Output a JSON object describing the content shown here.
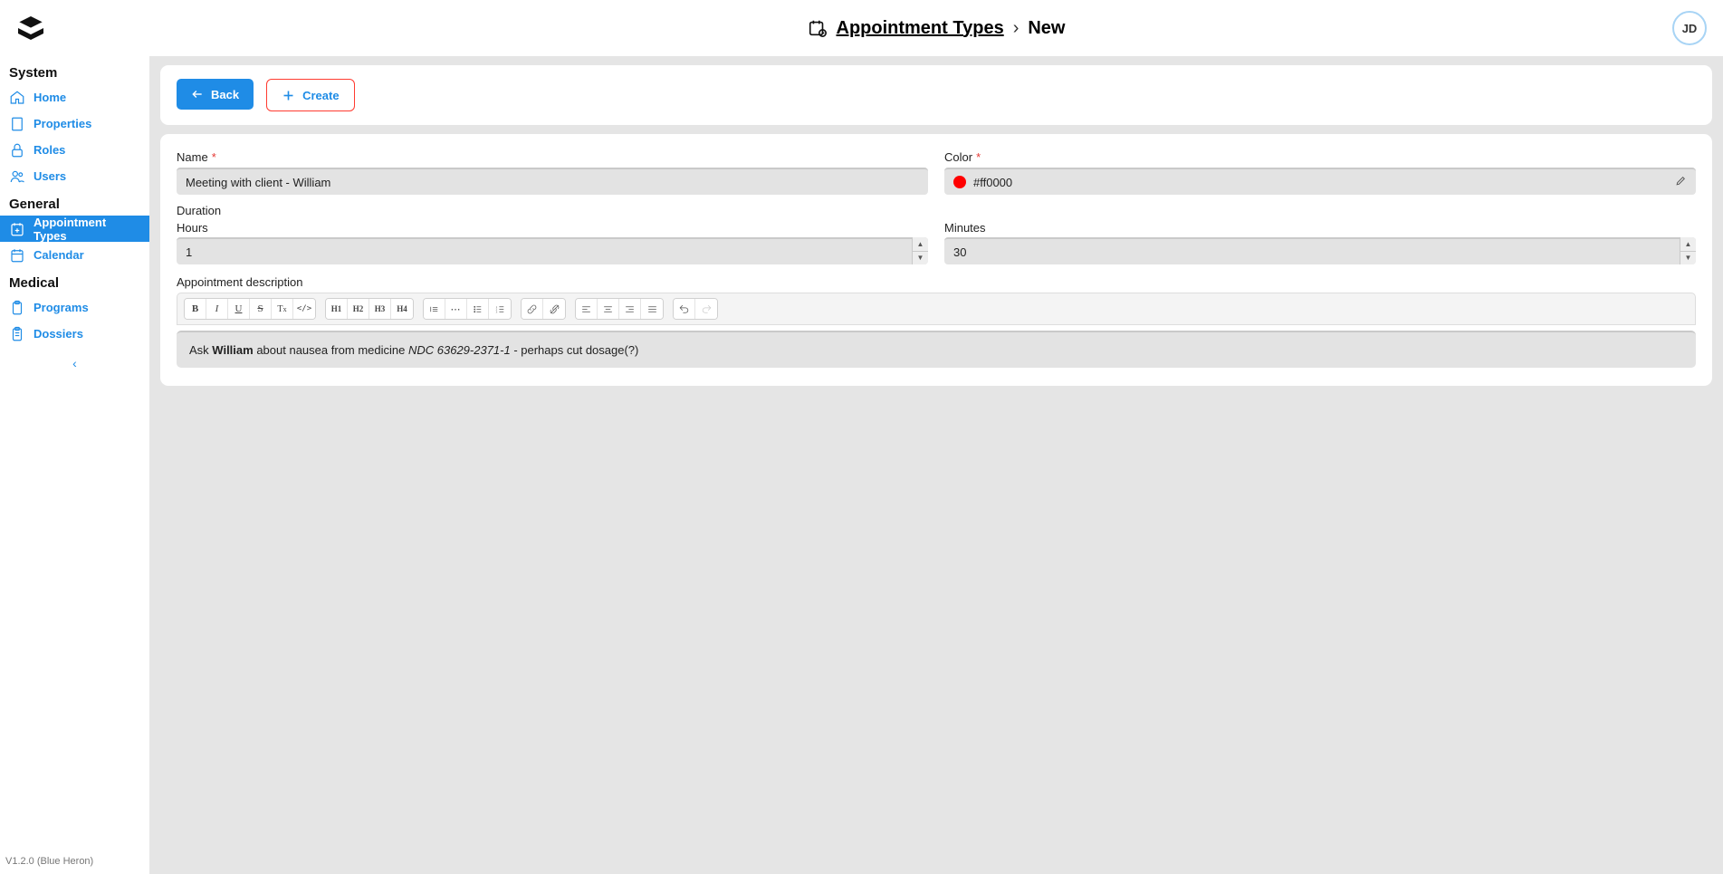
{
  "header": {
    "breadcrumb_link": "Appointment Types",
    "breadcrumb_sep": "›",
    "breadcrumb_current": "New",
    "avatar_initials": "JD"
  },
  "sidebar": {
    "sections": {
      "system": {
        "title": "System",
        "items": [
          {
            "label": "Home"
          },
          {
            "label": "Properties"
          },
          {
            "label": "Roles"
          },
          {
            "label": "Users"
          }
        ]
      },
      "general": {
        "title": "General",
        "items": [
          {
            "label": "Appointment Types",
            "active": true
          },
          {
            "label": "Calendar"
          }
        ]
      },
      "medical": {
        "title": "Medical",
        "items": [
          {
            "label": "Programs"
          },
          {
            "label": "Dossiers"
          }
        ]
      }
    },
    "version": "V1.2.0 (Blue Heron)"
  },
  "toolbar": {
    "back_label": "Back",
    "create_label": "Create"
  },
  "form": {
    "name_label": "Name",
    "name_value": "Meeting with client - William",
    "color_label": "Color",
    "color_hex": "#ff0000",
    "duration_label": "Duration",
    "hours_label": "Hours",
    "hours_value": "1",
    "minutes_label": "Minutes",
    "minutes_value": "30",
    "description_label": "Appointment description",
    "description_parts": {
      "p1": "Ask ",
      "p2_bold": "William",
      "p3": " about nausea from medicine ",
      "p4_italic": "NDC 63629-2371-1",
      "p5": " - perhaps cut dosage(?)"
    }
  },
  "editor_toolbar": {
    "g1": [
      "B",
      "I",
      "U",
      "S",
      "Tx",
      "</>"
    ],
    "g2": [
      "H1",
      "H2",
      "H3",
      "H4"
    ],
    "g3": [
      "quote",
      "hr",
      "ul",
      "ol"
    ],
    "g4": [
      "link",
      "unlink"
    ],
    "g5": [
      "align-l",
      "align-c",
      "align-r",
      "align-j"
    ],
    "g6": [
      "undo",
      "redo"
    ]
  }
}
